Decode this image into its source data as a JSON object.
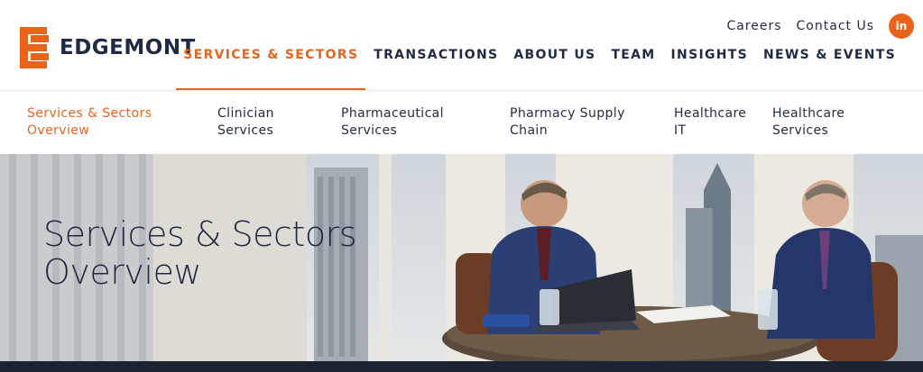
{
  "brand": {
    "name": "EDGEMONT",
    "accent": "#e8641b",
    "navy": "#1f2a44"
  },
  "utility": {
    "careers": "Careers",
    "contact": "Contact Us",
    "linkedin_icon": "linkedin-icon",
    "linkedin_text": "in"
  },
  "nav": {
    "items": [
      {
        "label": "SERVICES & SECTORS",
        "active": true
      },
      {
        "label": "TRANSACTIONS",
        "active": false
      },
      {
        "label": "ABOUT US",
        "active": false
      },
      {
        "label": "TEAM",
        "active": false
      },
      {
        "label": "INSIGHTS",
        "active": false
      },
      {
        "label": "NEWS & EVENTS",
        "active": false
      }
    ]
  },
  "subnav": {
    "items": [
      {
        "line1": "Services & Sectors",
        "line2": "Overview",
        "active": true
      },
      {
        "line1": "Clinician",
        "line2": "Services",
        "active": false
      },
      {
        "line1": "Pharmaceutical",
        "line2": "Services",
        "active": false
      },
      {
        "line1": "Pharmacy Supply",
        "line2": "Chain",
        "active": false
      },
      {
        "line1": "Healthcare",
        "line2": "IT",
        "active": false
      },
      {
        "line1": "Healthcare",
        "line2": "Services",
        "active": false
      }
    ]
  },
  "hero": {
    "title_line1": "Services & Sectors",
    "title_line2": "Overview"
  }
}
